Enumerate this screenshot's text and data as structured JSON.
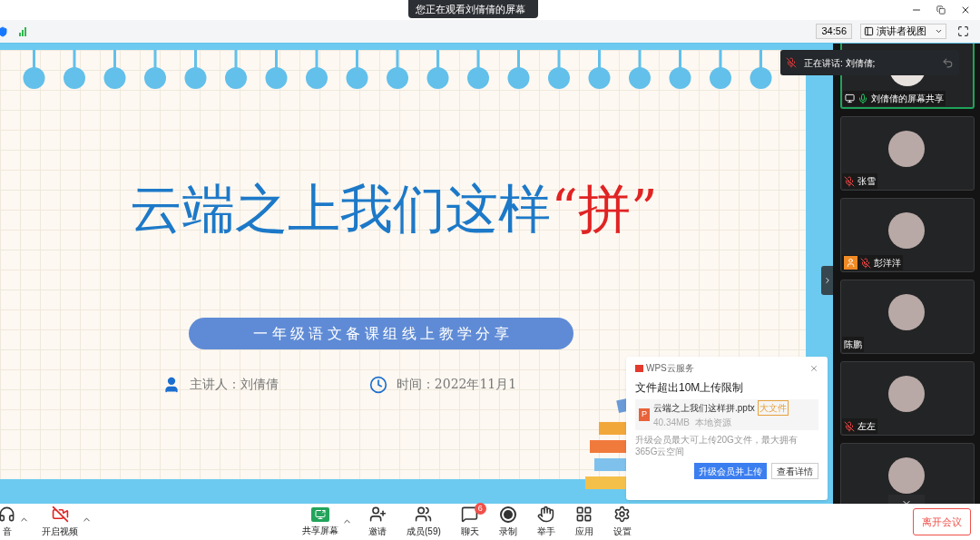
{
  "window": {
    "viewing_banner": "您正在观看刘倩倩的屏幕",
    "timer": "34:56",
    "view_mode": "演讲者视图"
  },
  "slide": {
    "title": "云端之上我们这样",
    "title_highlight": "“拼”",
    "subtitle": "一 年 级 语 文 备 课 组 线 上 教 学 分 享",
    "presenter": "主讲人：刘倩倩",
    "time": "时间：2022年11月1"
  },
  "popup": {
    "brand": "WPS云服务",
    "heading": "文件超出10M上传限制",
    "file_icon": "P",
    "file_name": "云端之上我们这样拼.pptx",
    "file_tag": "大文件",
    "file_meta": "40.34MB  本地资源",
    "note": "升级会员最大可上传20G文件，最大拥有365G云空间",
    "buttons": [
      {
        "label": "升级会员并上传",
        "primary": true
      },
      {
        "label": "查看详情",
        "primary": false
      }
    ]
  },
  "speaking": {
    "label": "正在讲话: 刘倩倩;",
    "muted": true
  },
  "participants": [
    {
      "name": "刘倩倩的屏幕共享",
      "kind": "screen",
      "audio": true,
      "muted": false,
      "selected": true
    },
    {
      "name": "张雪",
      "kind": "user",
      "audio": true,
      "muted": true,
      "selected": false
    },
    {
      "name": "彭洋洋",
      "kind": "host",
      "audio": true,
      "muted": true,
      "selected": false
    },
    {
      "name": "陈鹏",
      "kind": "user",
      "audio": false,
      "selected": false
    },
    {
      "name": "左左",
      "kind": "user",
      "audio": true,
      "muted": true,
      "selected": false
    },
    {
      "kind": "user",
      "audio": false,
      "selected": false
    }
  ],
  "toolbar_left": [
    {
      "label": "音",
      "kind": "audio",
      "caret": true
    },
    {
      "label": "开启视频",
      "kind": "video-off",
      "caret": true
    }
  ],
  "toolbar": [
    {
      "label": "共享屏幕",
      "kind": "share",
      "caret": true
    },
    {
      "label": "邀请",
      "kind": "invite",
      "caret": false
    },
    {
      "label": "成员(59)",
      "kind": "members",
      "caret": false
    },
    {
      "label": "聊天",
      "kind": "chat",
      "caret": false,
      "badge": "6"
    },
    {
      "label": "录制",
      "kind": "record",
      "caret": false
    },
    {
      "label": "举手",
      "kind": "hand",
      "caret": false
    },
    {
      "label": "应用",
      "kind": "apps",
      "caret": false
    },
    {
      "label": "设置",
      "kind": "settings",
      "caret": false
    }
  ],
  "leave_button": "离开会议"
}
